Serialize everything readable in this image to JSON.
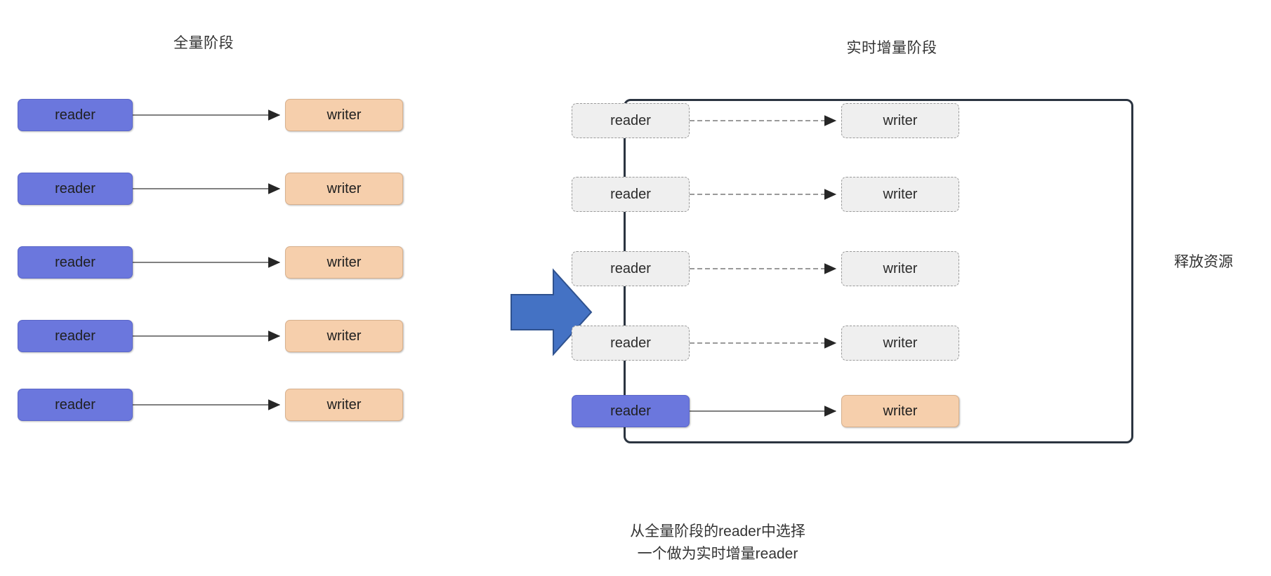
{
  "diagram": {
    "title_left": "全量阶段",
    "title_right": "实时增量阶段",
    "side_note": "释放资源",
    "caption_line1": "从全量阶段的reader中选择",
    "caption_line2": "一个做为实时增量reader",
    "colors": {
      "reader_fill": "#6b77dd",
      "reader_stroke": "#5a66c9",
      "writer_fill": "#f6cfac",
      "writer_stroke": "#d8b08c",
      "ghost_fill": "#efefef",
      "ghost_stroke": "#9a9a9a",
      "frame_stroke": "#2b3440",
      "big_arrow_fill": "#4472c4",
      "big_arrow_stroke": "#2f528f",
      "edge_solid": "#808080",
      "edge_dashed": "#9a9a9a",
      "text": "#333333"
    }
  },
  "full_stage": {
    "rows": [
      {
        "reader": "reader",
        "writer": "writer"
      },
      {
        "reader": "reader",
        "writer": "writer"
      },
      {
        "reader": "reader",
        "writer": "writer"
      },
      {
        "reader": "reader",
        "writer": "writer"
      },
      {
        "reader": "reader",
        "writer": "writer"
      }
    ]
  },
  "incremental_stage": {
    "released_rows": [
      {
        "reader": "reader",
        "writer": "writer"
      },
      {
        "reader": "reader",
        "writer": "writer"
      },
      {
        "reader": "reader",
        "writer": "writer"
      },
      {
        "reader": "reader",
        "writer": "writer"
      }
    ],
    "active_row": {
      "reader": "reader",
      "writer": "writer"
    }
  },
  "transition": {
    "icon": "right-block-arrow"
  }
}
